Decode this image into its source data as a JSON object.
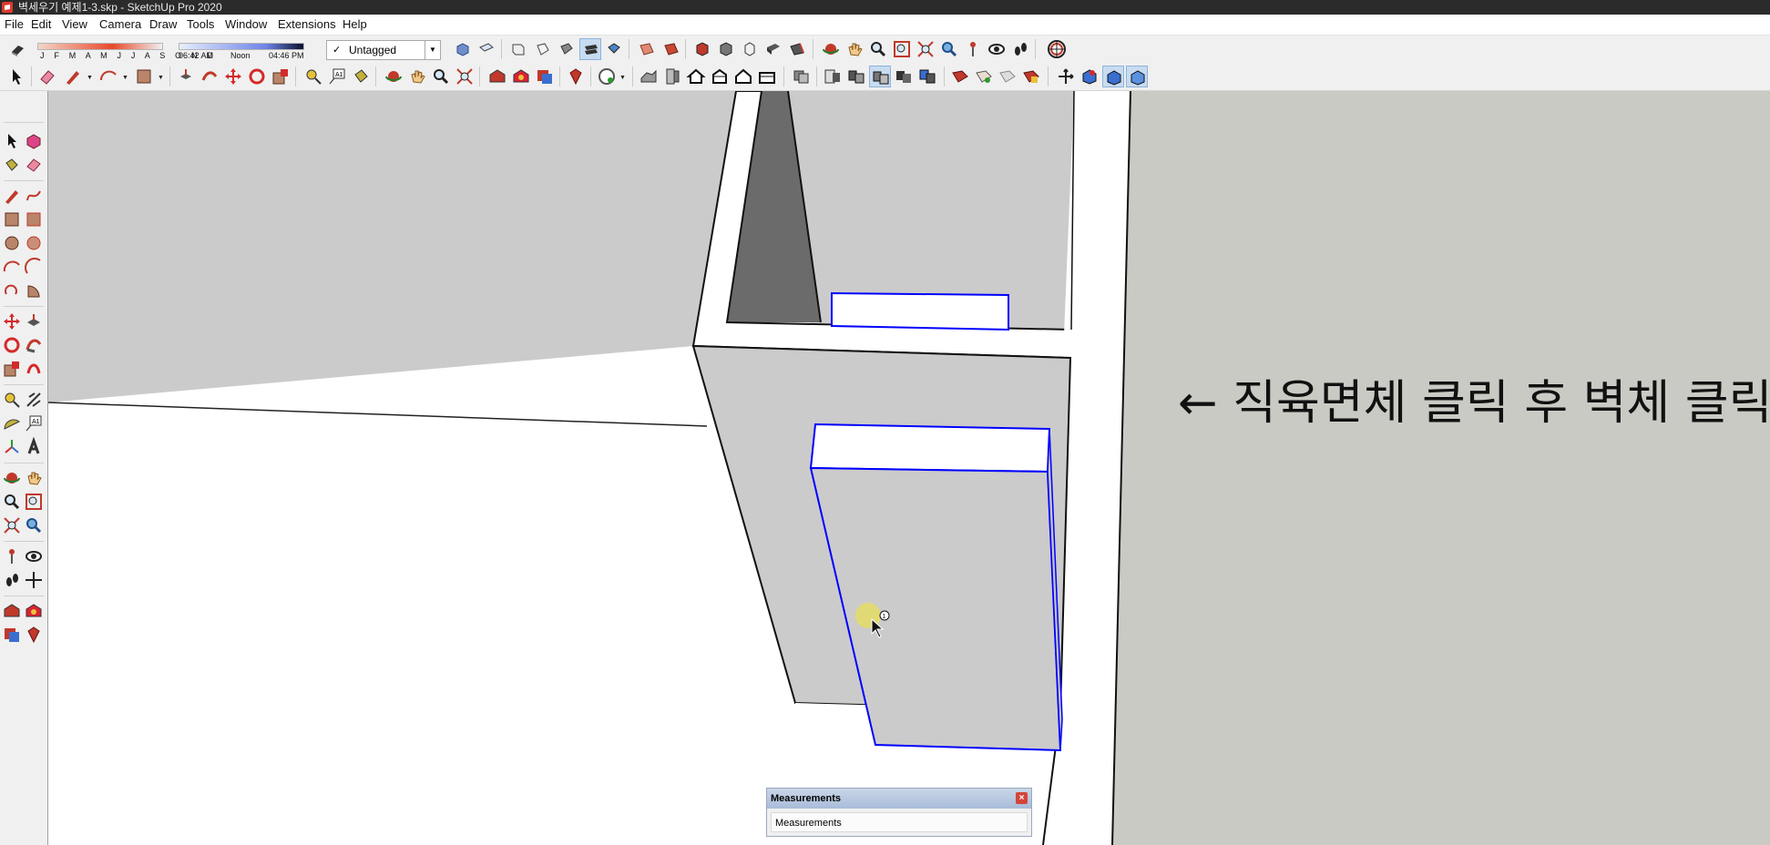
{
  "window": {
    "title": "벽세우기 예제1-3.skp - SketchUp Pro 2020"
  },
  "menu": [
    "File",
    "Edit",
    "View",
    "Camera",
    "Draw",
    "Tools",
    "Window",
    "Extensions",
    "Help"
  ],
  "shadows": {
    "months": "J F M A M J J A S O N D",
    "time_start": "06:42 AM",
    "time_mid": "Noon",
    "time_end": "04:46 PM"
  },
  "tag": {
    "selected": "Untagged"
  },
  "icons": {
    "toolbar1": [
      "eraser-shadow-icon",
      "iso-view-icon",
      "top-view-icon",
      "front-view-icon",
      "right-view-icon",
      "back-view-icon",
      "left-view-icon",
      "xray-icon",
      "back-edges-icon",
      "wireframe-icon",
      "hidden-line-icon",
      "shaded-icon",
      "shaded-textures-icon",
      "monochrome-icon",
      "follow-me-icon",
      "offset-icon",
      "push-pull-icon",
      "intersect-icon",
      "outer-shell-icon",
      "union-icon",
      "orbit-icon",
      "pan-icon",
      "zoom-icon",
      "zoom-window-icon",
      "zoom-extents-icon",
      "previous-view-icon",
      "position-camera-icon",
      "look-around-icon",
      "walk-icon",
      "geo-location-icon"
    ],
    "toolbar2": [
      "select-icon",
      "eraser-icon",
      "pencil-icon",
      "arc-icon",
      "rectangle-icon",
      "push-pull-icon",
      "follow-me-icon",
      "move-icon",
      "rotate-icon",
      "scale-icon",
      "tape-measure-icon",
      "text-icon",
      "paint-bucket-icon",
      "orbit-icon",
      "pan-icon",
      "zoom-icon",
      "zoom-extents-icon",
      "warehouse-icon",
      "extension-warehouse-icon",
      "send-layout-icon",
      "ruby-icon",
      "account-icon",
      "sandbox-icon",
      "add-detail-icon",
      "house-icon",
      "house-outline-icon",
      "gable-icon",
      "section-plane-icon",
      "section-cut-icon",
      "section-fill-icon",
      "component-icon",
      "group-icon",
      "solid-tools-icon",
      "trim-icon",
      "split-icon",
      "warehouse-share-icon",
      "3d-text-icon",
      "axes-icon",
      "dimension-icon",
      "protractor-icon",
      "view-layout-icon"
    ]
  },
  "scene": {
    "wall_fill": "#cbcbcb",
    "ground_fill": "#ffffff",
    "selection_color": "#0000ff"
  },
  "annotation": {
    "text": "← 직육면체 클릭 후 벽체 클릭"
  },
  "measurements": {
    "title": "Measurements",
    "label": "Measurements",
    "close": "×"
  }
}
